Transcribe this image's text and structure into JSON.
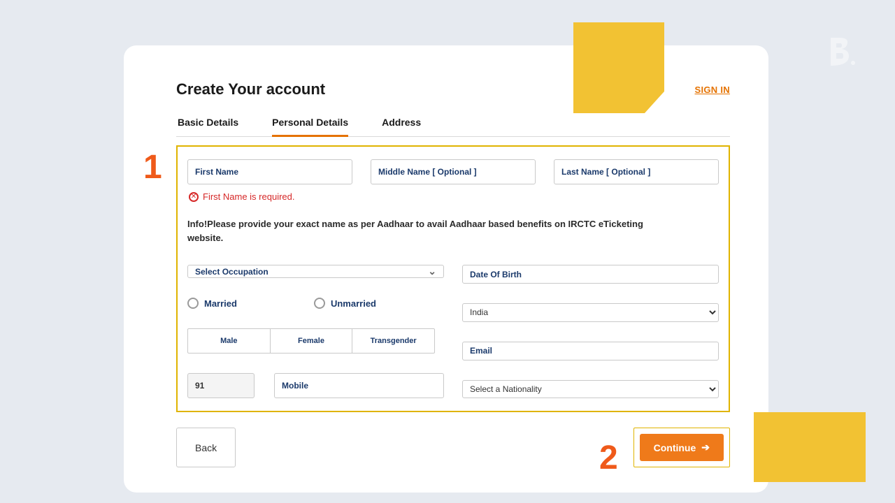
{
  "header": {
    "title": "Create Your account",
    "signin": "SIGN IN"
  },
  "tabs": {
    "basic": "Basic Details",
    "personal": "Personal Details",
    "address": "Address"
  },
  "fields": {
    "first_name": "First Name",
    "middle_name": "Middle Name  [ Optional ]",
    "last_name": "Last Name  [ Optional ]",
    "first_name_error": "First Name is required.",
    "info_text": "Info!Please provide your exact name as per Aadhaar to avail Aadhaar based benefits on IRCTC eTicketing website.",
    "occupation": "Select Occupation",
    "dob": "Date Of Birth",
    "married": "Married",
    "unmarried": "Unmarried",
    "country": "India",
    "male": "Male",
    "female": "Female",
    "transgender": "Transgender",
    "email": "Email",
    "country_code": "91",
    "mobile": "Mobile",
    "nationality": "Select a Nationality"
  },
  "buttons": {
    "back": "Back",
    "continue": "Continue"
  },
  "markers": {
    "one": "1",
    "two": "2"
  }
}
